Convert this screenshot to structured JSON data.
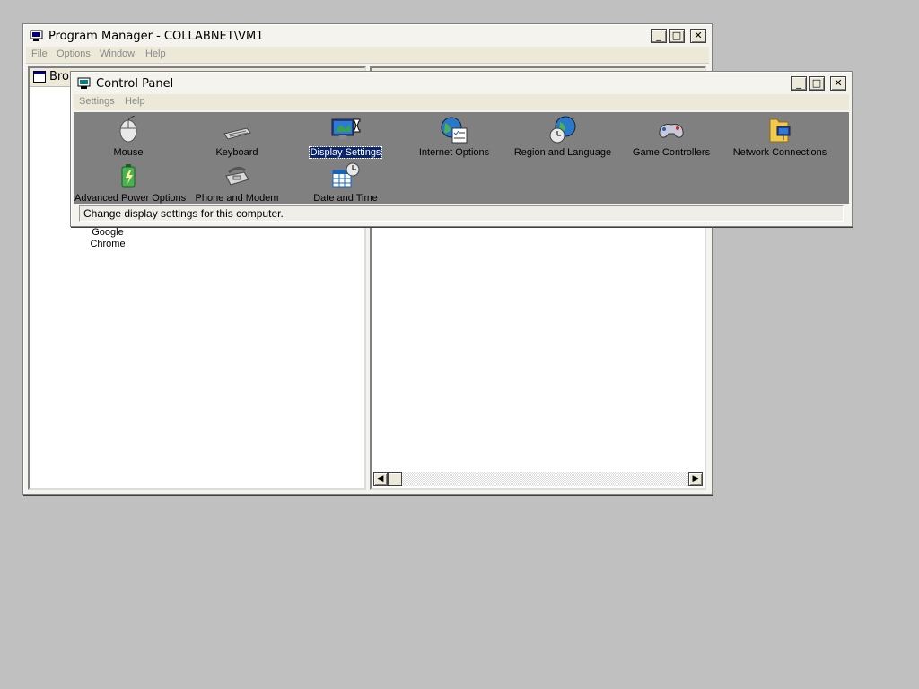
{
  "program_manager": {
    "title": "Program Manager - COLLABNET\\VM1",
    "menu": [
      "File",
      "Options",
      "Window",
      "Help"
    ],
    "left_pane_header": "Bro",
    "shortcut_label_line1": "Google",
    "shortcut_label_line2": "Chrome",
    "buttons": {
      "minimize": "_",
      "maximize": "□",
      "close": "✕"
    }
  },
  "control_panel": {
    "title": "Control Panel",
    "menu": [
      "Settings",
      "Help"
    ],
    "buttons": {
      "minimize": "_",
      "maximize": "□",
      "close": "✕"
    },
    "items": [
      {
        "label": "Mouse",
        "icon": "mouse-icon"
      },
      {
        "label": "Keyboard",
        "icon": "keyboard-icon"
      },
      {
        "label": "Display Settings",
        "icon": "display-icon",
        "selected": true
      },
      {
        "label": "Internet Options",
        "icon": "globe-checklist-icon"
      },
      {
        "label": "Region and Language",
        "icon": "globe-clock-icon"
      },
      {
        "label": "Game Controllers",
        "icon": "gamepad-icon"
      },
      {
        "label": "Network Connections",
        "icon": "network-folder-icon"
      },
      {
        "label": "Advanced Power Options",
        "icon": "battery-icon"
      },
      {
        "label": "Phone and Modem",
        "icon": "phone-icon"
      },
      {
        "label": "Date and Time",
        "icon": "calendar-clock-icon"
      }
    ],
    "status": "Change display settings for this computer."
  },
  "colors": {
    "desktop": "#c0c0c0",
    "icon_area": "#808080",
    "selection": "#0a246a"
  }
}
